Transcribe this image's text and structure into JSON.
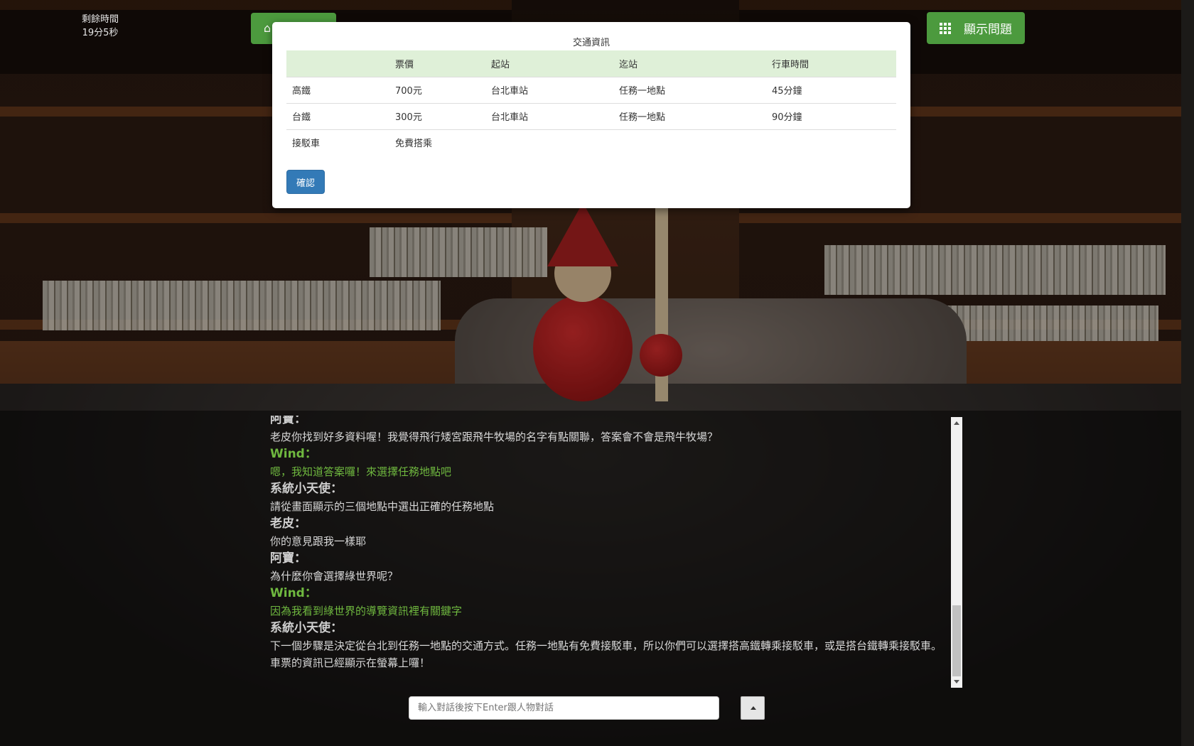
{
  "timer": {
    "label": "剩餘時間",
    "value": "19分5秒"
  },
  "home_button": {
    "icon": "home-icon"
  },
  "questions_button": {
    "label": "顯示問題",
    "icon": "grid-icon"
  },
  "modal": {
    "caption": "交通資訊",
    "headers": [
      "",
      "票價",
      "起站",
      "迄站",
      "行車時間"
    ],
    "rows": [
      [
        "高鐵",
        "700元",
        "台北車站",
        "任務一地點",
        "45分鐘"
      ],
      [
        "台鐵",
        "300元",
        "台北車站",
        "任務一地點",
        "90分鐘"
      ],
      [
        "接駁車",
        "免費搭乘",
        "",
        "",
        ""
      ]
    ],
    "confirm_label": "確認"
  },
  "chat": {
    "messages": [
      {
        "speaker": "阿寶：",
        "text": "老皮你找到好多資料喔！我覺得飛行矮宮跟飛牛牧場的名字有點關聯，答案會不會是飛牛牧場？",
        "green": false
      },
      {
        "speaker": "Wind：",
        "text": "嗯，我知道答案囉！來選擇任務地點吧",
        "green": true
      },
      {
        "speaker": "系統小天使：",
        "text": "請從畫面顯示的三個地點中選出正確的任務地點",
        "green": false
      },
      {
        "speaker": "老皮：",
        "text": "你的意見跟我一樣耶",
        "green": false
      },
      {
        "speaker": "阿寶：",
        "text": "為什麼你會選擇綠世界呢？",
        "green": false
      },
      {
        "speaker": "Wind：",
        "text": "因為我看到綠世界的導覽資訊裡有關鍵字",
        "green": true
      },
      {
        "speaker": "系統小天使：",
        "text": "下一個步驟是決定從台北到任務一地點的交通方式。任務一地點有免費接駁車，所以你們可以選擇搭高鐵轉乘接駁車，或是搭台鐵轉乘接駁車。車票的資訊已經顯示在螢幕上囉！",
        "green": false
      }
    ],
    "input_placeholder": "輸入對話後按下Enter跟人物對話"
  },
  "colors": {
    "accent_green": "#4c9a3e",
    "chat_green": "#6fb83f",
    "primary_blue": "#337ab7",
    "table_header": "#dff0d8"
  }
}
